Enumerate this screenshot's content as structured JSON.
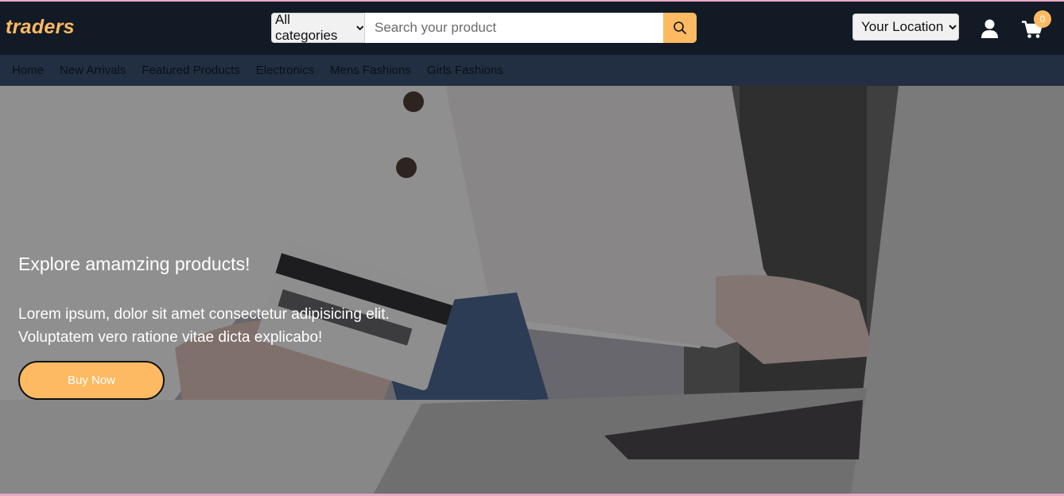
{
  "brand": {
    "logo_text": "traders"
  },
  "search": {
    "category_selected": "All categories",
    "placeholder": "Search your product"
  },
  "header": {
    "location_selected": "Your Location",
    "cart_count": "0"
  },
  "nav": {
    "items": [
      {
        "label": "Home"
      },
      {
        "label": "New Arrivals"
      },
      {
        "label": "Featured Products"
      },
      {
        "label": "Electronics"
      },
      {
        "label": "Mens Fashions"
      },
      {
        "label": "Girls Fashions"
      }
    ]
  },
  "hero": {
    "title": "Explore amamzing products!",
    "text_line1": "Lorem ipsum, dolor sit amet consectetur adipisicing elit.",
    "text_line2": "Voluptatem vero ratione vitae dicta explicabo!",
    "button_label": "Buy Now"
  },
  "icons": {
    "search": "search-icon",
    "user": "user-icon",
    "cart": "cart-icon",
    "dropdown": "chevron-down-icon"
  },
  "colors": {
    "header_bg": "#121a25",
    "nav_bg": "#222f42",
    "accent": "#feba62"
  }
}
